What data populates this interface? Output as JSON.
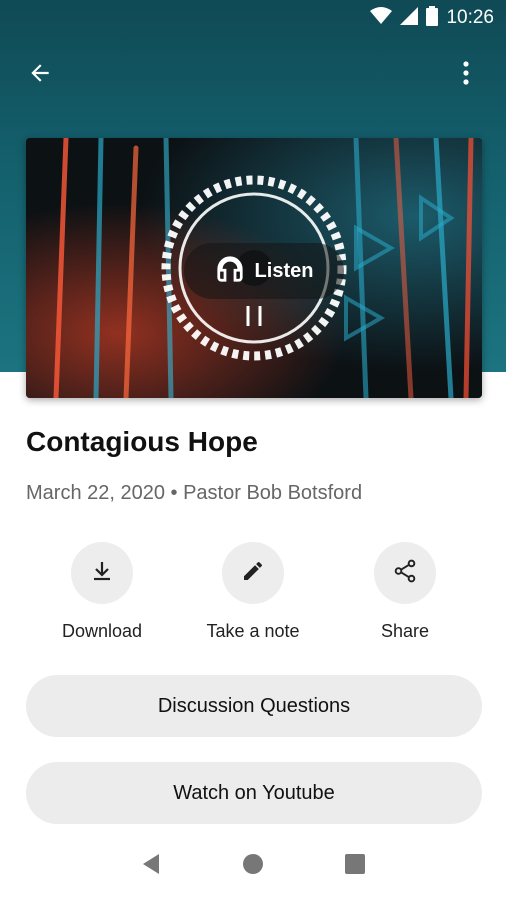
{
  "status_bar": {
    "time": "10:26",
    "icons": [
      "wifi-icon",
      "cellular-signal-icon",
      "battery-icon"
    ]
  },
  "app_bar": {
    "back_icon": "arrow-left-icon",
    "menu_icon": "more-vert-icon"
  },
  "hero": {
    "listen_label": "Listen",
    "listen_icon": "headphones-icon"
  },
  "sermon": {
    "title": "Contagious Hope",
    "meta": "March 22, 2020 • Pastor Bob Botsford"
  },
  "actions": [
    {
      "label": "Download",
      "icon": "download-icon"
    },
    {
      "label": "Take a note",
      "icon": "pencil-icon"
    },
    {
      "label": "Share",
      "icon": "share-icon"
    }
  ],
  "buttons": {
    "discussion": "Discussion Questions",
    "youtube": "Watch on Youtube"
  },
  "colors": {
    "header": "#14606d",
    "button_bg": "#ececed",
    "text_primary": "#111111",
    "text_secondary": "#666666"
  }
}
